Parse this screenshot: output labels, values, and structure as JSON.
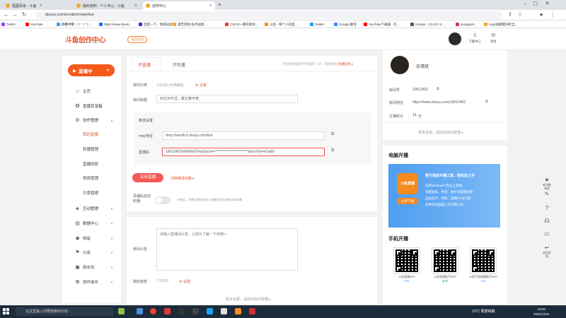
{
  "browser": {
    "tabs": [
      {
        "label": "抠图百余 - 斗鱼",
        "color": "#f6a623"
      },
      {
        "label": "我的资料 - 个人中心 - 斗鱼",
        "color": "#f6a623"
      },
      {
        "label": "创作中心",
        "color": "#f6a623"
      }
    ],
    "new_tab": "+",
    "url": "douyu.com/creator/main/live",
    "bookmarks": [
      {
        "label": "Twitch",
        "color": "#9146ff"
      },
      {
        "label": "YouTube",
        "color": "#ff0000"
      },
      {
        "label": "静馨神健（ゞ 'ゞ'ゞ...",
        "color": "#3aa0e8"
      },
      {
        "label": "https://www.faceb...",
        "color": "#1877f2"
      },
      {
        "label": "百度一下，你就知道",
        "color": "#2932e1"
      },
      {
        "label": "浦芝游戏-技术战绩...",
        "color": "#f6a623"
      },
      {
        "label": "CSGO一键开放资...",
        "color": "#e53935"
      },
      {
        "label": "斗鱼 - 每个人的直...",
        "color": "#f58a1f"
      },
      {
        "label": "Twitter",
        "color": "#1da1f2"
      },
      {
        "label": "Google 翻译",
        "color": "#4285f4"
      },
      {
        "label": "YouTube下载器 - 在...",
        "color": "#ff0000"
      },
      {
        "label": "s1mple - CS:GO S...",
        "color": "#555555"
      },
      {
        "label": "instagram",
        "color": "#c13584"
      },
      {
        "label": "csgo快捷键开枪当...",
        "color": "#f6a623"
      }
    ]
  },
  "header": {
    "logo_text": "斗鱼创作中心",
    "logo_sub": "DOUYU CREATION CENTER",
    "back_home": "返回主站",
    "download_label": "下载中心",
    "message_label": "消息"
  },
  "sidebar": {
    "live_button": "直播中",
    "items": [
      {
        "label": "主页",
        "icon": "home-icon",
        "glyph": "⌂"
      },
      {
        "label": "直播百宝箱",
        "icon": "toolbox-icon",
        "glyph": "✪"
      },
      {
        "label": "创作管理",
        "icon": "create-icon",
        "glyph": "⚙"
      }
    ],
    "subitems": [
      "我的直播",
      "轮播管理",
      "直播回放",
      "视频管理",
      "文章管理"
    ],
    "groups": [
      {
        "label": "互动管理",
        "icon": "interact-icon",
        "glyph": "◈"
      },
      {
        "label": "数据中心",
        "icon": "data-icon",
        "glyph": "▤"
      },
      {
        "label": "收益",
        "icon": "income-icon",
        "glyph": "◉"
      },
      {
        "label": "公会",
        "icon": "guild-icon",
        "glyph": "⚑"
      },
      {
        "label": "商业化",
        "icon": "business-icon",
        "glyph": "▣"
      },
      {
        "label": "创作成长",
        "icon": "growth-icon",
        "glyph": "✿"
      }
    ]
  },
  "main": {
    "tabs": [
      "开直播",
      "开轮播"
    ],
    "tip_text": "你已经领取新手开播的一切，前往体验",
    "tip_link": "直播指南 ▸",
    "category_label": "房间分类",
    "category_value": "CS:GO-大神做伯",
    "category_action": "⚙ 设置",
    "title_label": "房间标题",
    "title_value": "对又对不过，菜又菜不死",
    "push_settings_label": "推流设置",
    "rtmp_label": "rtmp地址",
    "rtmp_value": "rtmp://sendtc3.douyu.com/live",
    "code_label": "直播码",
    "code_value": "10012402rWnMlor9?wsSecret=************************&wsTime=63a69",
    "close_button": "关闭直播",
    "switch_link": "切换推流线路 ▸",
    "auto_label": "关播后自动轮播",
    "auto_desc": "开启后，关播后将自动进入轮播不跟主机推流请关播",
    "notice_label": "房间公告",
    "notice_placeholder": "请输入直播间公告，让观众了解一下你吧～",
    "my_tag_label": "我的标签",
    "my_tag_value": "CS:GO",
    "my_tag_action": "⚙ 设置",
    "more_settings": "更多设置，请前往房间管理 ▸"
  },
  "profile": {
    "name": "忠惜班",
    "room_no_label": "房间号",
    "room_no": "10012402",
    "room_url_label": "房间地址",
    "room_url": "https://www.douyu.com/10012402",
    "points_label": "主播积分",
    "points": "11",
    "points_unit": "分",
    "more_info": "更多信息，请前往房间管理 ▸"
  },
  "pc_live": {
    "title": "电脑开播",
    "banner_logo": "斗鱼直播",
    "banner_title": "官方指定开播工具，轻松加上手",
    "banner_lines": [
      "支持Windows7及以上系统",
      "海量道具、手游、图片等直播场景",
      "自由变声、特效、直播PK多功能",
      "多种实时画面上方开播工具"
    ],
    "download_button": "立即下载"
  },
  "mobile_live": {
    "title": "手机开播",
    "apps": [
      {
        "name": "斗鱼直播APP",
        "os": "iOS",
        "os_class": ""
      },
      {
        "name": "斗鱼直播助手APP",
        "os": "安卓",
        "os_class": "g"
      },
      {
        "name": "斗鱼手游直播助手APP",
        "os": "iOS",
        "os_class": ""
      }
    ]
  },
  "float_bar": [
    {
      "label": "新功能体验",
      "icon": "new-icon",
      "glyph": "★"
    },
    {
      "label": "",
      "icon": "edit-icon",
      "glyph": "✎"
    },
    {
      "label": "",
      "icon": "help-icon",
      "glyph": "?"
    },
    {
      "label": "",
      "icon": "headset-icon",
      "glyph": "☊"
    },
    {
      "label": "",
      "icon": "monitor-icon",
      "glyph": "▭"
    },
    {
      "label": "返回旧版",
      "icon": "back-icon",
      "glyph": "↩"
    }
  ],
  "taskbar": {
    "search_placeholder": "在这里输入你要搜索的内容",
    "weather": "13°C 局部晴朗",
    "time": "13:59",
    "date": "2022/12/24"
  }
}
